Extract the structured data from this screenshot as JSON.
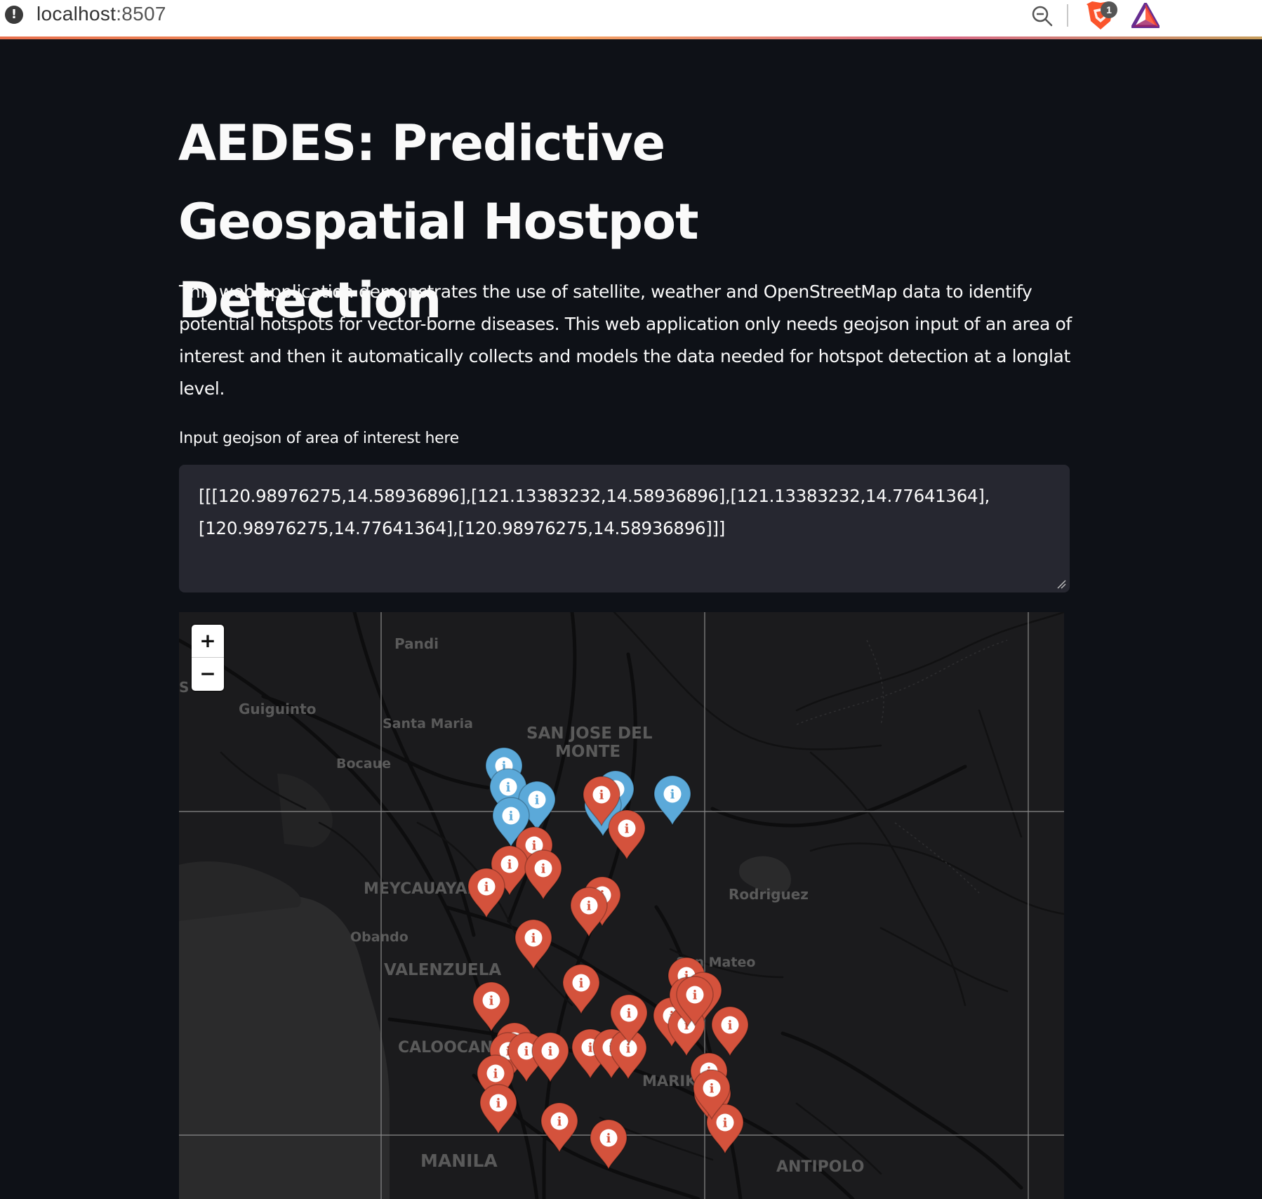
{
  "browser": {
    "url_host": "localhost",
    "url_port": ":8507",
    "brave_badge_count": "1"
  },
  "page": {
    "title": "AEDES: Predictive Geospatial Hostpot Detection",
    "description": "This web application demonstrates the use of satellite, weather and OpenStreetMap data to identify potential hotspots for vector-borne diseases. This web application only needs geojson input of an area of interest and then it automatically collects and models the data needed for hotspot detection at a longlat level.",
    "input_label": "Input geojson of area of interest here",
    "input_value": "[[[120.98976275,14.58936896],[121.13383232,14.58936896],[121.13383232,14.77641364],[120.98976275,14.77641364],[120.98976275,14.58936896]]]"
  },
  "map": {
    "zoom_in_label": "+",
    "zoom_out_label": "−",
    "places": [
      {
        "name": "Pandi"
      },
      {
        "name": "S"
      },
      {
        "name": "Guiguinto"
      },
      {
        "name": "Santa Maria"
      },
      {
        "name": "SAN JOSE DEL"
      },
      {
        "name": "MONTE"
      },
      {
        "name": "Bocaue"
      },
      {
        "name": "MEYCAUAYAN"
      },
      {
        "name": "Rodriguez"
      },
      {
        "name": "Obando"
      },
      {
        "name": "San Mateo"
      },
      {
        "name": "VALENZUELA"
      },
      {
        "name": "CALOOCAN"
      },
      {
        "name": "MARIK"
      },
      {
        "name": "MANILA"
      },
      {
        "name": "ANTIPOLO"
      }
    ],
    "marker_icon": "info-icon",
    "marker_colors": {
      "low": "#5ba9d9",
      "high": "#d4523c"
    }
  }
}
